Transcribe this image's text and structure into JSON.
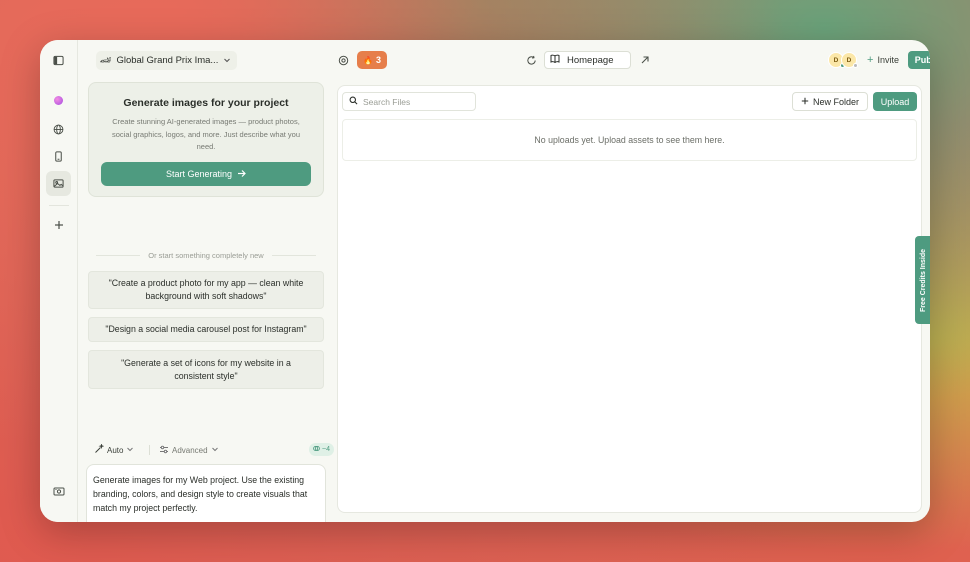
{
  "topbar": {
    "project_icon": "racing-car-emoji",
    "project_emoji": "🏎",
    "project_name": "Global Grand Prix Ima...",
    "fire_emoji": "🔥",
    "streak_count": "3",
    "page_name": "Homepage",
    "avatars": [
      {
        "initial": "D",
        "status_color": "#4e9b80"
      },
      {
        "initial": "D",
        "status_color": "#bbbbbb"
      }
    ],
    "invite_label": "Invite",
    "publish_label": "Publish"
  },
  "generator": {
    "title": "Generate images for your project",
    "description": "Create stunning AI-generated images — product photos, social graphics, logos, and more. Just describe what you need.",
    "button_label": "Start Generating"
  },
  "divider_text": "Or start something completely new",
  "suggestions": [
    "\"Create a product photo for my app — clean white background with soft shadows\"",
    "\"Design a social media carousel post for Instagram\"",
    "\"Generate a set of icons for my website in a consistent style\""
  ],
  "options": {
    "mode_label": "Auto",
    "advanced_label": "Advanced",
    "credits_label": "~4"
  },
  "prompt": {
    "text": "Generate images for my Web project. Use the existing branding, colors, and design style to create visuals that match my project perfectly."
  },
  "files": {
    "search_placeholder": "Search Files",
    "new_folder_label": "New Folder",
    "upload_label": "Upload",
    "empty_message": "No uploads yet. Upload assets to see them here."
  },
  "side_tab_label": "Free Credits Inside",
  "colors": {
    "accent": "#4e9b80",
    "streak": "#e67e4a"
  }
}
